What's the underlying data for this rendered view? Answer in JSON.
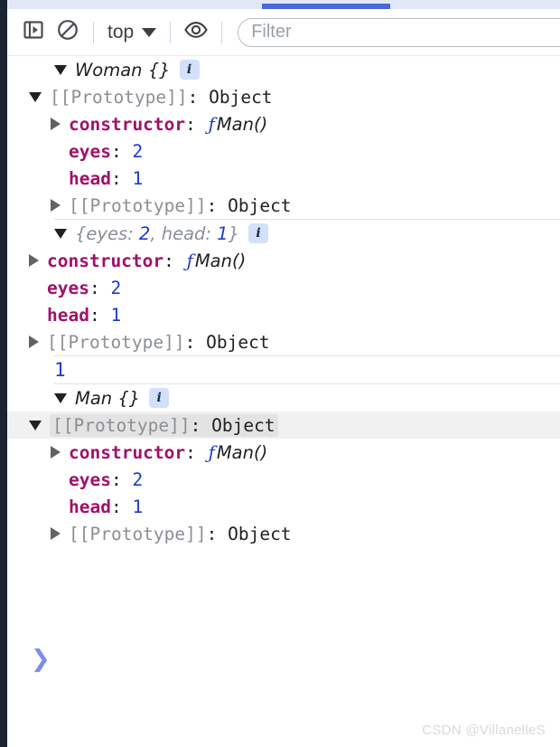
{
  "window": {
    "tab_indicator_color": "#4a68d8",
    "tabstrip_bg": "#e1e7f7"
  },
  "toolbar": {
    "sidebar_toggle_icon": "show-sidebar-icon",
    "clear_console_icon": "clear-console-icon",
    "context_label": "top",
    "context_caret_icon": "chevron-down-icon",
    "live_expression_icon": "eye-icon",
    "filter_placeholder": "Filter",
    "filter_value": ""
  },
  "console": {
    "entries": [
      {
        "kind": "object-group",
        "header_prefix": "Woman",
        "header_braces": "{}",
        "badge": "i",
        "rows": [
          {
            "indent": 2,
            "arrow": "open",
            "key": "[[Prototype]]",
            "value": "Object",
            "type": "proto"
          },
          {
            "indent": 3,
            "arrow": "closed",
            "key": "constructor",
            "value": "Man()",
            "type": "function"
          },
          {
            "indent": 3,
            "arrow": "none",
            "key": "eyes",
            "value": "2",
            "type": "number"
          },
          {
            "indent": 3,
            "arrow": "none",
            "key": "head",
            "value": "1",
            "type": "number"
          },
          {
            "indent": 3,
            "arrow": "closed",
            "key": "[[Prototype]]",
            "value": "Object",
            "type": "proto"
          }
        ]
      },
      {
        "kind": "literal-group",
        "literal_open": "{",
        "literal_parts": [
          {
            "key": "eyes",
            "value": "2"
          },
          {
            "key": "head",
            "value": "1"
          }
        ],
        "literal_close": "}",
        "badge": "i",
        "rows": [
          {
            "indent": 2,
            "arrow": "closed",
            "key": "constructor",
            "value": "Man()",
            "type": "function"
          },
          {
            "indent": 2,
            "arrow": "none",
            "key": "eyes",
            "value": "2",
            "type": "number"
          },
          {
            "indent": 2,
            "arrow": "none",
            "key": "head",
            "value": "1",
            "type": "number"
          },
          {
            "indent": 2,
            "arrow": "closed",
            "key": "[[Prototype]]",
            "value": "Object",
            "type": "proto"
          }
        ]
      },
      {
        "kind": "value",
        "value": "1"
      },
      {
        "kind": "object-group",
        "header_prefix": "Man",
        "header_braces": "{}",
        "badge": "i",
        "rows": [
          {
            "indent": 2,
            "arrow": "open",
            "key": "[[Prototype]]",
            "value": "Object",
            "type": "proto",
            "hovered": true
          },
          {
            "indent": 3,
            "arrow": "closed",
            "key": "constructor",
            "value": "Man()",
            "type": "function"
          },
          {
            "indent": 3,
            "arrow": "none",
            "key": "eyes",
            "value": "2",
            "type": "number"
          },
          {
            "indent": 3,
            "arrow": "none",
            "key": "head",
            "value": "1",
            "type": "number"
          },
          {
            "indent": 3,
            "arrow": "closed",
            "key": "[[Prototype]]",
            "value": "Object",
            "type": "proto"
          }
        ]
      }
    ]
  },
  "prompt": {
    "chevron": "❯",
    "value": ""
  },
  "watermark": "CSDN @VillanelleS",
  "colors": {
    "key_magenta": "#a0116b",
    "number_blue": "#1a3cc8",
    "proto_gray": "#8a8f94",
    "accent_blue": "#4a68d8"
  }
}
